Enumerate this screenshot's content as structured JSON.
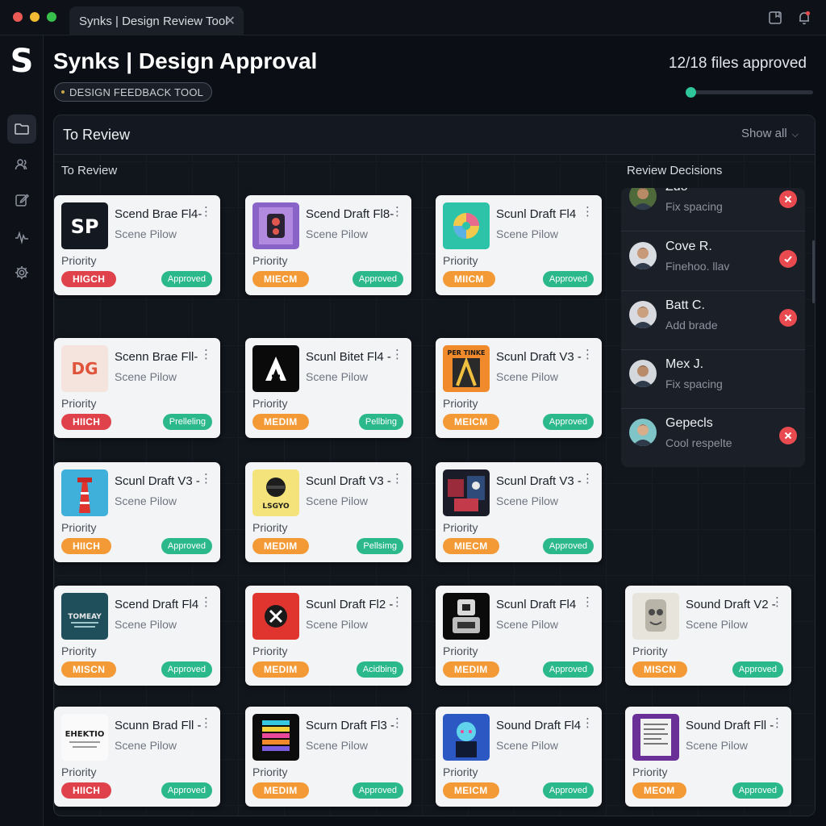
{
  "window": {
    "tab_title": "Synks | Design Review Tool",
    "tab_close": "✕"
  },
  "sidebar": {
    "logo": "S",
    "items": [
      {
        "icon": "folder-icon",
        "active": true
      },
      {
        "icon": "users-icon",
        "active": false
      },
      {
        "icon": "edit-icon",
        "active": false
      },
      {
        "icon": "activity-icon",
        "active": false
      },
      {
        "icon": "settings-icon",
        "active": false
      }
    ]
  },
  "header": {
    "title": "Synks | Design Approval",
    "tag": "DESIGN FEEDBACK TOOL",
    "progress_text": "12/18 files approved",
    "progress_fraction": 0.0
  },
  "panel": {
    "title": "To Review",
    "show_all": "Show all",
    "show_all_chevron": "⌵",
    "col_left": "To Review",
    "col_right": "Review Decisions"
  },
  "cards": [
    {
      "title": "Scend Brae Fl4-",
      "subtitle": "Scene Pilow",
      "priority_label": "Priority",
      "priority": "HIGCH",
      "priority_level": "high",
      "status": "Approved",
      "thumb": "sp",
      "menu": "⋮"
    },
    {
      "title": "Scend Draft Fl8-",
      "subtitle": "Scene Pilow",
      "priority_label": "Priority",
      "priority": "MIECM",
      "priority_level": "med",
      "status": "Approved",
      "thumb": "purple",
      "menu": "⋮"
    },
    {
      "title": "Scunl Draft Fl4",
      "subtitle": "Scene Pilow",
      "priority_label": "Priority",
      "priority": "MIICM",
      "priority_level": "med",
      "status": "Approved",
      "thumb": "teal",
      "menu": "⋮"
    },
    {
      "title": "Scenn Brae Fll-",
      "subtitle": "Scene Pilow",
      "priority_label": "Priority",
      "priority": "HIICH",
      "priority_level": "high",
      "status": "Prelleling",
      "thumb": "dg",
      "menu": "⋮"
    },
    {
      "title": "Scunl Bitet Fl4 -",
      "subtitle": "Scene Pilow",
      "priority_label": "Priority",
      "priority": "MEDIM",
      "priority_level": "med",
      "status": "Pellbing",
      "thumb": "a",
      "menu": "⋮"
    },
    {
      "title": "Scunl Draft V3 -",
      "subtitle": "Scene Pilow",
      "priority_label": "Priority",
      "priority": "MEICM",
      "priority_level": "med",
      "status": "Approved",
      "thumb": "poster",
      "thumb_text": "PER TINKE",
      "menu": "⋮"
    },
    {
      "title": "Scunl Draft V3 -",
      "subtitle": "Scene Pilow",
      "priority_label": "Priority",
      "priority": "HIICH",
      "priority_level": "med",
      "status": "Approved",
      "thumb": "tower",
      "menu": "⋮"
    },
    {
      "title": "Scunl Draft V3 -",
      "subtitle": "Scene Pilow",
      "priority_label": "Priority",
      "priority": "MEDIM",
      "priority_level": "med",
      "status": "Pellsimg",
      "thumb": "yellow",
      "thumb_text": "LSGYO",
      "menu": "⋮"
    },
    {
      "title": "Scunl Draft V3 -",
      "subtitle": "Scene Pilow",
      "priority_label": "Priority",
      "priority": "MIECM",
      "priority_level": "med",
      "status": "Approved",
      "thumb": "dark",
      "menu": "⋮"
    },
    {
      "title": "Scend Draft Fl4",
      "subtitle": "Scene Pilow",
      "priority_label": "Priority",
      "priority": "MISCN",
      "priority_level": "med",
      "status": "Approved",
      "thumb": "tomey",
      "thumb_text": "TOMEAY",
      "menu": "⋮"
    },
    {
      "title": "Scunl Draft Fl2 -",
      "subtitle": "Scene Pilow",
      "priority_label": "Priority",
      "priority": "MEDIM",
      "priority_level": "med",
      "status": "Acidbing",
      "thumb": "redx",
      "menu": "⋮"
    },
    {
      "title": "Scunl Draft Fl4",
      "subtitle": "Scene Pilow",
      "priority_label": "Priority",
      "priority": "MEDIM",
      "priority_level": "med",
      "status": "Approved",
      "thumb": "machine",
      "menu": "⋮"
    },
    {
      "title": "Sound Draft V2 -",
      "subtitle": "Scene Pilow",
      "priority_label": "Priority",
      "priority": "MISCN",
      "priority_level": "med",
      "status": "Approved",
      "thumb": "sketch",
      "menu": "⋮"
    },
    {
      "title": "Scunn Brad Fll -",
      "subtitle": "Scene Pilow",
      "priority_label": "Priority",
      "priority": "HIICH",
      "priority_level": "high",
      "status": "Approved",
      "thumb": "ehektio",
      "thumb_text": "EHEKTIO",
      "menu": "⋮"
    },
    {
      "title": "Scurn Draft Fl3 -",
      "subtitle": "Scene Pilow",
      "priority_label": "Priority",
      "priority": "MEDIM",
      "priority_level": "med",
      "status": "Approved",
      "thumb": "rainbow",
      "menu": "⋮"
    },
    {
      "title": "Sound Draft Fl4",
      "subtitle": "Scene Pilow",
      "priority_label": "Priority",
      "priority": "MEICM",
      "priority_level": "med",
      "status": "Approved",
      "thumb": "blue",
      "menu": "⋮"
    },
    {
      "title": "Sound Draft Fll -",
      "subtitle": "Scene Pilow",
      "priority_label": "Priority",
      "priority": "MEOM",
      "priority_level": "med",
      "status": "Approved",
      "thumb": "doc",
      "menu": "⋮"
    }
  ],
  "reviews": [
    {
      "name": "Zuo",
      "note": "Fix spacing",
      "decision": "rejected",
      "skin": "#b98a66",
      "bg": "#4f6a3a"
    },
    {
      "name": "Cove R.",
      "note": "Finehoo. llav",
      "decision": "approved",
      "skin": "#c99a79",
      "bg": "#d9dde2"
    },
    {
      "name": "Batt C.",
      "note": "Add brade",
      "decision": "rejected",
      "skin": "#caa07e",
      "bg": "#d8dadf"
    },
    {
      "name": "Mex J.",
      "note": "Fix spacing",
      "decision": "none",
      "skin": "#b98b6a",
      "bg": "#d4d8dd"
    },
    {
      "name": "Gepecls",
      "note": "Cool respelte",
      "decision": "rejected",
      "skin": "#d8ad8c",
      "bg": "#7fc4c7"
    }
  ],
  "colors": {
    "high": "#e0424b",
    "medium": "#f39a36",
    "approved": "#2bb88a",
    "reject": "#e84a4f",
    "accent": "#2fc79a"
  }
}
